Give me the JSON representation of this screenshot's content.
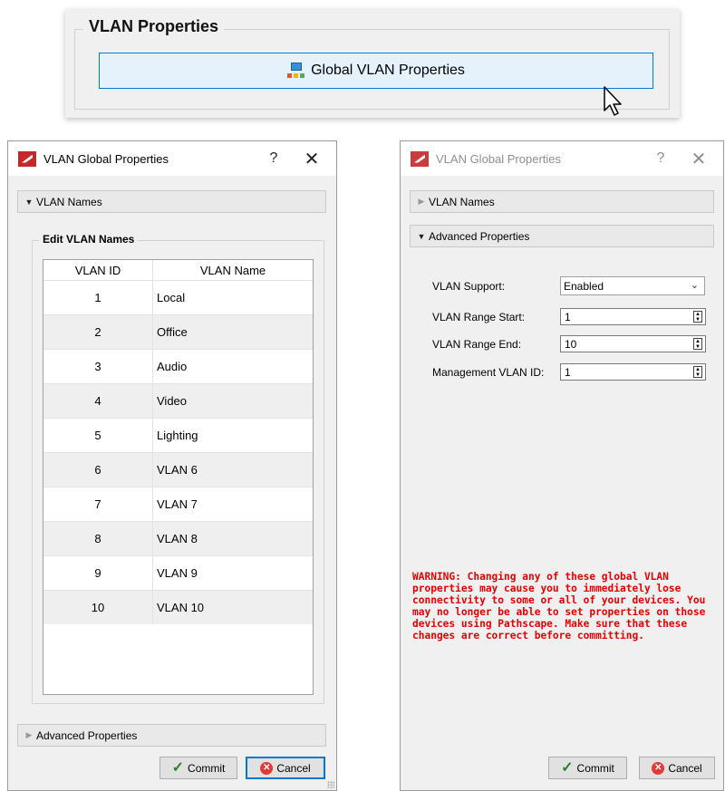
{
  "top_panel": {
    "group_title": "VLAN Properties",
    "button_label": "Global VLAN Properties",
    "button_icon": "network-icon"
  },
  "left_dialog": {
    "title": "VLAN Global Properties",
    "help": "?",
    "close": "✕",
    "section_vlan_names": "VLAN Names",
    "group_title": "Edit VLAN Names",
    "table": {
      "headers": [
        "VLAN ID",
        "VLAN Name"
      ],
      "rows": [
        {
          "id": "1",
          "name": "Local"
        },
        {
          "id": "2",
          "name": "Office"
        },
        {
          "id": "3",
          "name": "Audio"
        },
        {
          "id": "4",
          "name": "Video"
        },
        {
          "id": "5",
          "name": "Lighting"
        },
        {
          "id": "6",
          "name": "VLAN 6"
        },
        {
          "id": "7",
          "name": "VLAN 7"
        },
        {
          "id": "8",
          "name": "VLAN 8"
        },
        {
          "id": "9",
          "name": "VLAN 9"
        },
        {
          "id": "10",
          "name": "VLAN 10"
        }
      ]
    },
    "section_advanced": "Advanced Properties",
    "commit_label": "Commit",
    "cancel_label": "Cancel"
  },
  "right_dialog": {
    "title": "VLAN Global Properties",
    "help": "?",
    "close": "✕",
    "section_vlan_names": "VLAN Names",
    "section_advanced": "Advanced Properties",
    "vlan_support_label": "VLAN Support:",
    "vlan_support_value": "Enabled",
    "range_start_label": "VLAN Range Start:",
    "range_start_value": "1",
    "range_end_label": "VLAN Range End:",
    "range_end_value": "10",
    "mgmt_label": "Management VLAN ID:",
    "mgmt_value": "1",
    "warning": "WARNING:  Changing any of these global VLAN properties may cause you to immediately lose connectivity to some or all of your devices.  You may no longer be able to set properties on those devices using Pathscape. Make sure that these changes are correct before committing.",
    "commit_label": "Commit",
    "cancel_label": "Cancel"
  },
  "colors": {
    "accent": "#0078d7",
    "warning": "#e60000",
    "dialog_bg": "#f0f0f0",
    "app_icon": "#c62828"
  }
}
